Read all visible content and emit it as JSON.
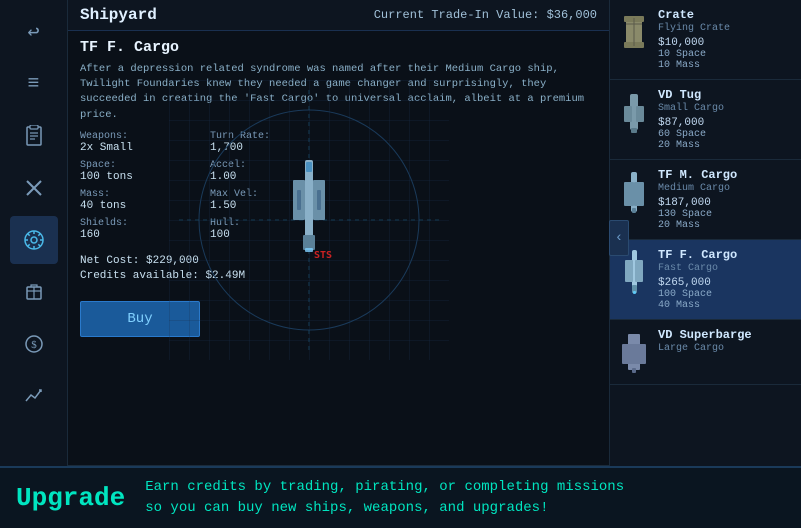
{
  "header": {
    "title": "Shipyard",
    "trade_in_label": "Current Trade-In Value:",
    "trade_in_value": "$36,000"
  },
  "selected_ship": {
    "name": "TF F. Cargo",
    "description": "After a depression related syndrome was named after their Medium Cargo ship, Twilight Foundaries knew they needed a game changer and surprisingly, they succeeded in creating the 'Fast Cargo' to universal acclaim, albeit at a premium price.",
    "stats": {
      "weapons_label": "Weapons:",
      "weapons_value": "2x Small",
      "turn_rate_label": "Turn Rate:",
      "turn_rate_value": "1,700",
      "space_label": "Space:",
      "space_value": "100 tons",
      "accel_label": "Accel:",
      "accel_value": "1.00",
      "mass_label": "Mass:",
      "mass_value": "40 tons",
      "max_vel_label": "Max Vel:",
      "max_vel_value": "1.50",
      "shields_label": "Shields:",
      "shields_value": "160",
      "hull_label": "Hull:",
      "hull_value": "100"
    },
    "net_cost_label": "Net Cost:",
    "net_cost_value": "$229,000",
    "credits_label": "Credits available:",
    "credits_value": "$2.49M",
    "buy_label": "Buy"
  },
  "ship_list": [
    {
      "name": "Crate",
      "type": "Flying Crate",
      "price": "$10,000",
      "stat1": "10 Space",
      "stat2": "10 Mass",
      "selected": false
    },
    {
      "name": "VD Tug",
      "type": "Small Cargo",
      "price": "$87,000",
      "stat1": "60 Space",
      "stat2": "20 Mass",
      "selected": false
    },
    {
      "name": "TF M. Cargo",
      "type": "Medium Cargo",
      "price": "$187,000",
      "stat1": "130 Space",
      "stat2": "20 Mass",
      "selected": false
    },
    {
      "name": "TF F. Cargo",
      "type": "Fast Cargo",
      "price": "$265,000",
      "stat1": "100 Space",
      "stat2": "40 Mass",
      "selected": true
    },
    {
      "name": "VD Superbarge",
      "type": "Large Cargo",
      "price": "",
      "stat1": "",
      "stat2": "",
      "selected": false
    }
  ],
  "sidebar": {
    "icons": [
      {
        "name": "back-icon",
        "symbol": "↩",
        "active": false
      },
      {
        "name": "menu-icon",
        "symbol": "☰",
        "active": false
      },
      {
        "name": "clipboard-icon",
        "symbol": "📋",
        "active": false
      },
      {
        "name": "tools-icon",
        "symbol": "✕",
        "active": false
      },
      {
        "name": "helm-icon",
        "symbol": "✿",
        "active": true
      },
      {
        "name": "cargo-icon",
        "symbol": "📦",
        "active": false
      },
      {
        "name": "credits-icon",
        "symbol": "＄",
        "active": false
      },
      {
        "name": "chart-icon",
        "symbol": "📈",
        "active": false
      }
    ]
  },
  "upgrade_bar": {
    "label": "Upgrade",
    "text_line1": "Earn credits by trading, pirating, or completing missions",
    "text_line2": "so you can buy new ships, weapons, and upgrades!"
  },
  "grid_marker": "STS",
  "right_toggle": "‹"
}
